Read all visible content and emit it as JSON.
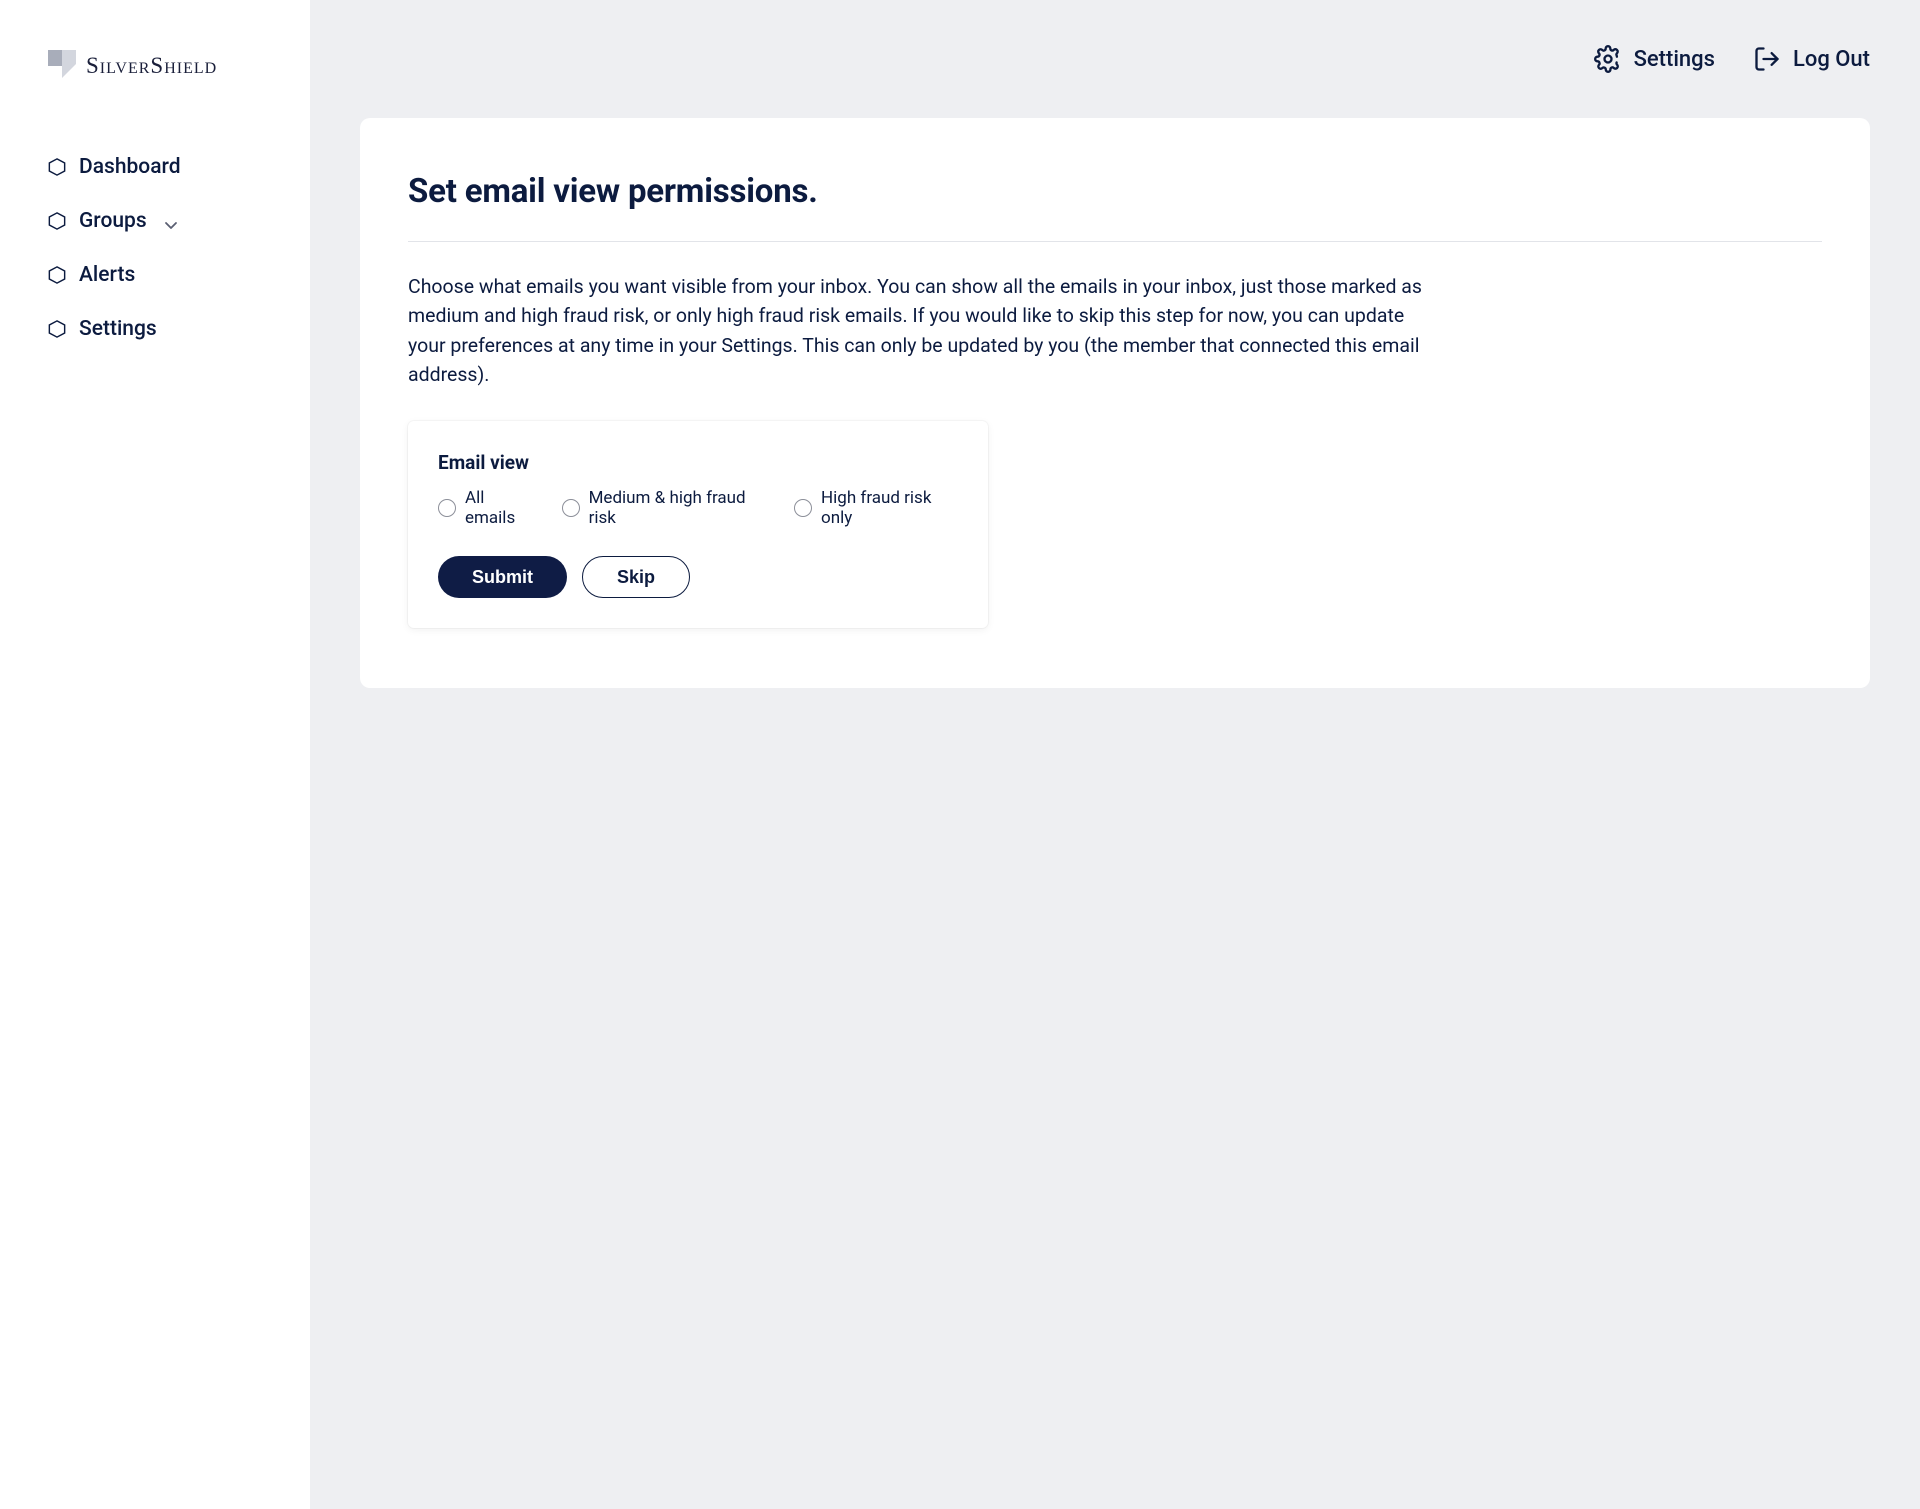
{
  "brand": {
    "name": "SilverShield"
  },
  "sidebar": {
    "items": [
      {
        "label": "Dashboard"
      },
      {
        "label": "Groups",
        "expandable": true
      },
      {
        "label": "Alerts"
      },
      {
        "label": "Settings"
      }
    ]
  },
  "topbar": {
    "settings_label": "Settings",
    "logout_label": "Log Out"
  },
  "page": {
    "title": "Set email view permissions.",
    "description": "Choose what emails you want visible from your inbox. You can show all the emails in your inbox, just those marked as medium and high fraud risk, or only high fraud risk emails. If you would like to skip this step for now, you can update your preferences at any time in your Settings. This can only be updated by you (the member that connected this email address)."
  },
  "form": {
    "section_label": "Email view",
    "options": [
      {
        "label": "All emails"
      },
      {
        "label": "Medium & high fraud risk"
      },
      {
        "label": "High fraud risk only"
      }
    ],
    "submit_label": "Submit",
    "skip_label": "Skip"
  }
}
